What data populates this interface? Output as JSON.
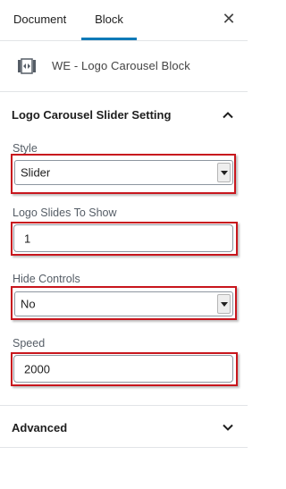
{
  "tabs": {
    "document_label": "Document",
    "block_label": "Block",
    "active": "Block"
  },
  "block_card": {
    "title": "WE - Logo Carousel Block",
    "icon": "carousel-block-icon"
  },
  "panel": {
    "title": "Logo Carousel Slider Setting",
    "expanded": true
  },
  "fields": {
    "style": {
      "label": "Style",
      "value": "Slider"
    },
    "logo_slides": {
      "label": "Logo Slides To Show",
      "value": "1"
    },
    "hide_controls": {
      "label": "Hide Controls",
      "value": "No"
    },
    "speed": {
      "label": "Speed",
      "value": "2000"
    }
  },
  "advanced": {
    "title": "Advanced",
    "expanded": false
  },
  "colors": {
    "tab_accent": "#0f7ab8",
    "highlight_red": "#c8161d"
  }
}
